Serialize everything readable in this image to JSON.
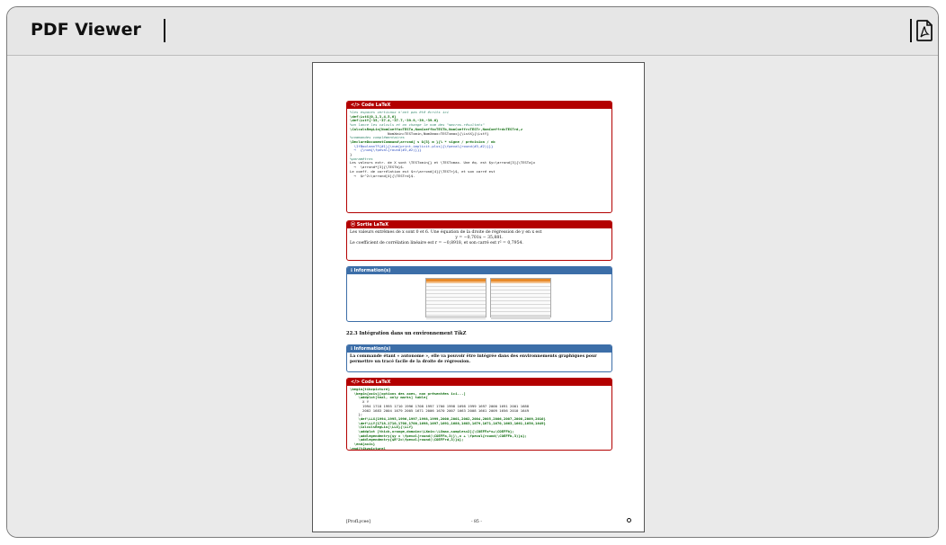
{
  "window": {
    "title": "PDF Viewer",
    "pdf_icon": "pdf-file-icon"
  },
  "page": {
    "code1": {
      "header": "</> Code LaTeX",
      "lines": [
        {
          "cls": "cm",
          "t": "%les espaces verticaux n'ont pas été écrits ici"
        },
        {
          "cls": "kw",
          "t": "\\def\\LstX{0,1,3,4,5,6}"
        },
        {
          "cls": "kw",
          "t": "\\def\\LstY{-35,-37.4,-37.7,-39.9,-39,-39.6}"
        },
        {
          "cls": "cm",
          "t": "%on lance les calculs et on change le nom des \"macros-résultats\""
        },
        {
          "cls": "kw",
          "t": "\\CalculsRegLin[NomCoeffa=TESTa,NomCoeffb=TESTb,NomCoeffr=TESTr,NomCoeffrd=TESTrd,⤶"
        },
        {
          "cls": "",
          "t": "                  NomXmin=TESTxmin,NomXmax=TESTxmax]{\\LstX}{\\LstY}"
        },
        {
          "cls": "cm",
          "t": "%commandes complémentaires"
        },
        {
          "cls": "kw",
          "t": "\\DeclareDocumentCommand\\arrond{ s O{3} m }{% * signe / précision / nb"
        },
        {
          "cls": "ar",
          "t": "  \\IfBooleanTF{#1}{\\num[print-implicit-plus]{\\fpeval{round(#3,#2)}}}"
        },
        {
          "cls": "ar",
          "t": "  ↪  {\\num{\\fpeval{round(#3,#2)}}}"
        },
        {
          "cls": "",
          "t": "}"
        },
        {
          "cls": "cm",
          "t": "%paramètres"
        },
        {
          "cls": "",
          "t": "Les valeurs extr. de X sont \\TESTxmin{} et \\TESTxmax. Une éq. est $y=\\arrond[3]{\\TESTa}x"
        },
        {
          "cls": "",
          "t": "  ↪  \\arrond*[3]{\\TESTb}$."
        },
        {
          "cls": "",
          "t": "Le coeff. de corrélation est $r=\\arrond[4]{\\TESTr}$, et son carré est"
        },
        {
          "cls": "",
          "t": "  ↪  $r^2=\\arrond[4]{\\TESTrd}$."
        }
      ]
    },
    "output": {
      "header": "⦿ Sortie LaTeX",
      "line1": "Les valeurs extrêmes de x sont 0 et 6. Une équation de la droite de régression de y en x est",
      "line2": "y = −0,701x − 35,881.",
      "line3": "Le coefficient de corrélation linéaire est r = −0,8918, et son carré est r² = 0,7954."
    },
    "info1": {
      "header": "ℹ Information(s)"
    },
    "section": "22.3   Intégration dans un environnement TikZ",
    "info2": {
      "header": "ℹ Information(s)",
      "line1": "La commande étant « autonome », elle va pouvoir être intégrée dans des environnements graphiques pour",
      "line2": "permettre un tracé facile de la droite de régression."
    },
    "code2": {
      "header": "</> Code LaTeX",
      "lines": [
        {
          "cls": "kw",
          "t": "\\begin{tikzpicture}"
        },
        {
          "cls": "kw",
          "t": "  \\begin{axis}[options des axes, non présentées ici...]"
        },
        {
          "cls": "kw",
          "t": "    \\addplot[teal, only marks] table{"
        },
        {
          "cls": "",
          "t": "      X Y"
        },
        {
          "cls": "",
          "t": "      1994 1718 1995 1710 1996 1708 1997 1700 1998 1698 1999 1697 2000 1691 2001 1688"
        },
        {
          "cls": "",
          "t": "      2002 1683 2004 1679 2005 1671 2006 1670 2007 1663 2008 1661 2009 1656 2010 1649"
        },
        {
          "cls": "",
          "t": "    };"
        },
        {
          "cls": "kw",
          "t": "    \\def\\LLX{1994,1995,1996,1997,1998,1999,2000,2001,2002,2004,2005,2006,2007,2008,2009,2010}"
        },
        {
          "cls": "kw",
          "t": "    \\def\\LLY{1718,1710,1708,1700,1698,1697,1691,1688,1683,1679,1671,1670,1663,1661,1656,1649}"
        },
        {
          "cls": "kw",
          "t": "    \\CalculsRegLin{\\LLX}{\\LLY}"
        },
        {
          "cls": "kw",
          "t": "    \\addplot [thick,orange,domain=\\LXmin:\\LXmax,samples=2]{\\COEFFa*x+\\COEFFb};"
        },
        {
          "cls": "kw",
          "t": "    \\addlegendentry{$y = \\fpeval{round(\\COEFFa,3)}\\,x + \\fpeval{round(\\COEFFb,3)}$};"
        },
        {
          "cls": "kw",
          "t": "    \\addlegendentry{$R^2=\\fpeval{round(\\COEFFrd,3)}$};"
        },
        {
          "cls": "kw",
          "t": "  \\end{axis}"
        },
        {
          "cls": "kw",
          "t": "\\end{tikzpicture}"
        }
      ]
    },
    "footer": {
      "left": "[ProfLycee]",
      "center": "- 85 -"
    }
  },
  "colors": {
    "code_red": "#b30000",
    "info_blue": "#3c6ea8"
  }
}
